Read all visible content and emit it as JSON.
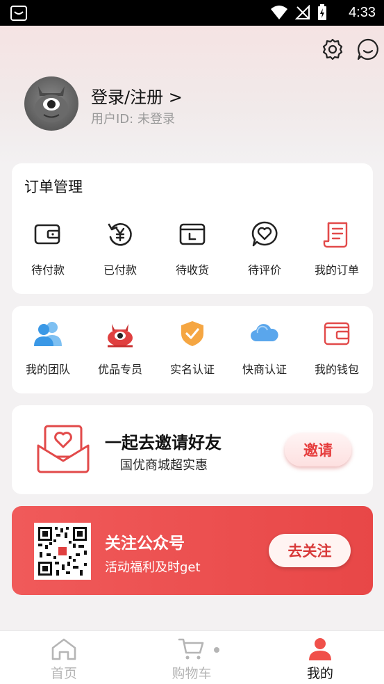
{
  "status_bar": {
    "time": "4:33"
  },
  "profile": {
    "login_label": "登录/注册 >",
    "uid_label": "用户ID:  未登录"
  },
  "orders": {
    "title": "订单管理",
    "items": [
      {
        "label": "待付款",
        "icon": "wallet-icon"
      },
      {
        "label": "已付款",
        "icon": "yuan-refresh-icon"
      },
      {
        "label": "待收货",
        "icon": "package-icon"
      },
      {
        "label": "待评价",
        "icon": "heart-chat-icon"
      },
      {
        "label": "我的订单",
        "icon": "document-icon"
      }
    ]
  },
  "services": {
    "items": [
      {
        "label": "我的团队",
        "icon": "team-icon"
      },
      {
        "label": "优品专员",
        "icon": "monster-icon"
      },
      {
        "label": "实名认证",
        "icon": "shield-check-icon"
      },
      {
        "label": "快商认证",
        "icon": "cloud-icon"
      },
      {
        "label": "我的钱包",
        "icon": "wallet-card-icon"
      }
    ]
  },
  "invite": {
    "title": "一起去邀请好友",
    "subtitle": "国优商城超实惠",
    "button": "邀请"
  },
  "follow": {
    "title": "关注公众号",
    "subtitle": "活动福利及时get",
    "button": "去关注"
  },
  "tabbar": {
    "tabs": [
      {
        "label": "首页",
        "icon": "home-icon"
      },
      {
        "label": "购物车",
        "icon": "cart-icon"
      },
      {
        "label": "我的",
        "icon": "person-icon"
      }
    ]
  },
  "colors": {
    "accent": "#e84747",
    "icon_red": "#e24a4a"
  }
}
